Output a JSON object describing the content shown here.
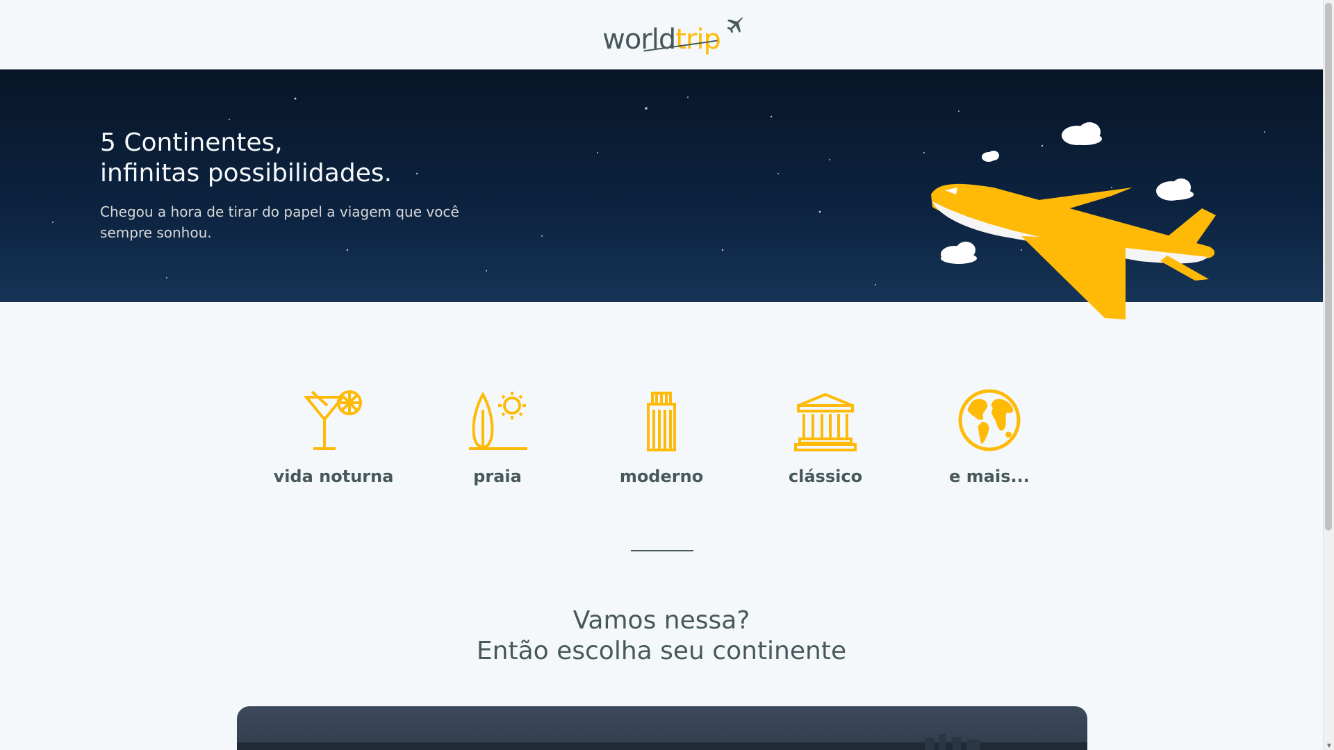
{
  "header": {
    "logo_world": "world",
    "logo_trip": "trip",
    "logo_icon": "airplane-icon"
  },
  "hero": {
    "title_line1": "5 Continentes,",
    "title_line2": "infinitas possibilidades.",
    "subtitle": "Chegou a hora de tirar do papel a viagem que você sempre sonhou.",
    "illustration": "airplane-illustration"
  },
  "categories": [
    {
      "label": "vida noturna",
      "icon": "cocktail-icon"
    },
    {
      "label": "praia",
      "icon": "surfboard-sun-icon"
    },
    {
      "label": "moderno",
      "icon": "building-icon"
    },
    {
      "label": "clássico",
      "icon": "museum-icon"
    },
    {
      "label": "e mais...",
      "icon": "globe-icon"
    }
  ],
  "cta": {
    "line1": "Vamos nessa?",
    "line2": "Então escolha seu continente"
  },
  "colors": {
    "accent": "#ffba08",
    "text": "#47585b",
    "background": "#f5f8fa",
    "hero_bg": "#0c2340"
  }
}
